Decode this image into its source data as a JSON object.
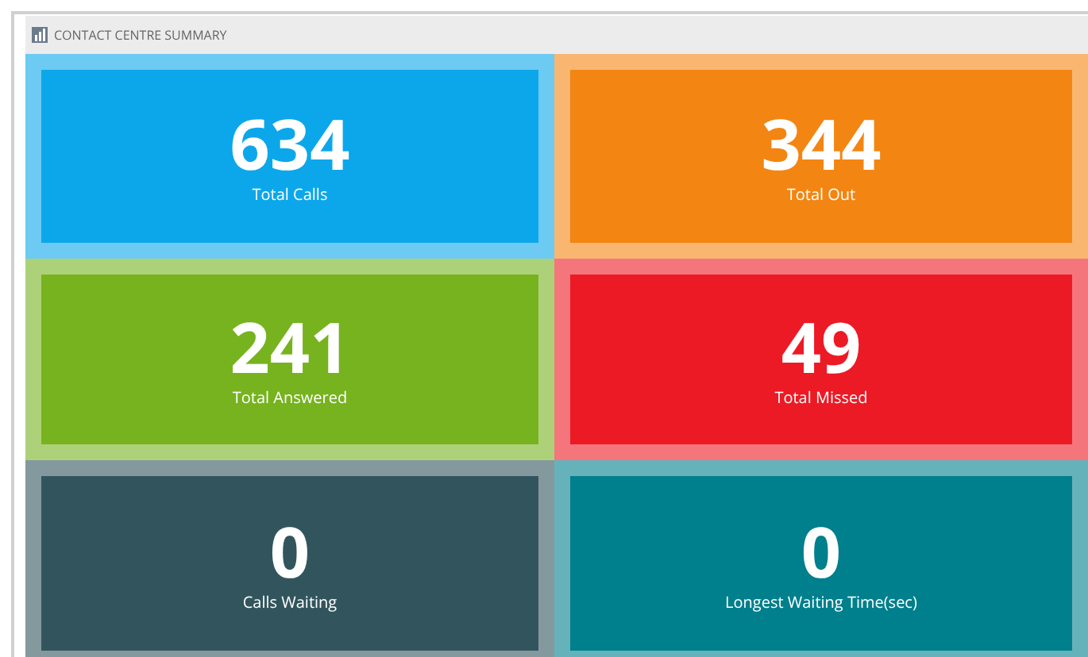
{
  "panel": {
    "title": "CONTACT CENTRE SUMMARY"
  },
  "tiles": [
    {
      "value": "634",
      "label": "Total Calls",
      "color": "#0ca7ea"
    },
    {
      "value": "344",
      "label": "Total Out",
      "color": "#f38512"
    },
    {
      "value": "241",
      "label": "Total Answered",
      "color": "#76b31f"
    },
    {
      "value": "49",
      "label": "Total Missed",
      "color": "#ec1a25"
    },
    {
      "value": "0",
      "label": "Calls Waiting",
      "color": "#32555d"
    },
    {
      "value": "0",
      "label": "Longest Waiting Time(sec)",
      "color": "#007f8c"
    }
  ]
}
